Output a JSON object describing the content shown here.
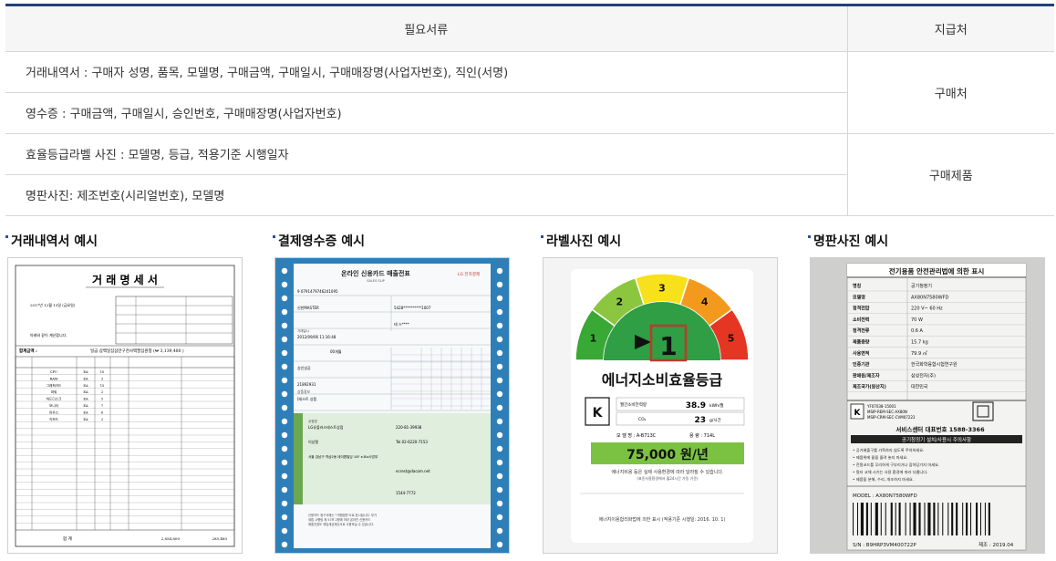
{
  "table": {
    "header_docs": "필요서류",
    "header_where": "지급처",
    "rows": [
      {
        "doc": "거래내역서 : 구매자 성명, 품목, 모델명, 구매금액, 구매일시, 구매매장명(사업자번호), 직인(서명)"
      },
      {
        "doc": "영수증 : 구매금액, 구매일시, 승인번호, 구매매장명(사업자번호)"
      },
      {
        "doc": "효율등급라벨 사진 : 모델명, 등급, 적용기준 시행일자"
      },
      {
        "doc": "명판사진: 제조번호(시리얼번호), 모델명"
      }
    ],
    "groups": [
      "구매처",
      "구매제품"
    ]
  },
  "examples": [
    {
      "title": "거래내역서 예시"
    },
    {
      "title": "결제영수증 예시"
    },
    {
      "title": "라벨사진 예시"
    },
    {
      "title": "명판사진 예시"
    }
  ],
  "invoice": {
    "title": "거 래 명 세 서",
    "date": "2017년 12월 13일 (금요일)",
    "sum_label": "합계금액 :",
    "sum_text": "일금 삼백일십삼만구천사백팔십원정 (₩ 3,139,480 )",
    "note": "아래와 같이 계산합니다.",
    "items": [
      "CPU",
      "RAM",
      "그래픽카드",
      "파워",
      "하드디스크",
      "모니터",
      "마우스",
      "키보드"
    ],
    "qtys": [
      "10",
      "3",
      "15",
      "2",
      "5",
      "7",
      "6",
      "2"
    ],
    "total_label": "합 계",
    "total_amount": "2,854,800",
    "total_tax": "285,480"
  },
  "receipt": {
    "title": "온라인 신용카드 매출전표",
    "subtitle": "SALES SLIP",
    "brand": "LG 전자결제",
    "card_no": "9 0791479746241095",
    "card_type": "신한MASTER",
    "card_num": "5428**********1007",
    "cust_name": "테 스****",
    "date_label": "거래일시",
    "date": "2012/09/06 11:16:48",
    "installment": "00개월",
    "status": "승인성공",
    "approval": "21892931",
    "product_label": "상품정보",
    "product": "[테스트 상품",
    "merchant_label": "상점명",
    "merchant": "LG유플러스테스트상점",
    "biz_no": "220-81-39938",
    "ceo": "이상철",
    "phone": "Tel.02-6220-7153",
    "address": "서울 강남구 역삼2동 데이콤빌딩 10F e-Biz사업부",
    "email": "ecrest@dacom.net",
    "cs_no": "1544-7772",
    "footer": "신용카드 청구서에는 \"가맹점명\"으로 표시됩니다. 부가세법 시행령 제 57조 2항에 따라 온라인 신용카드 매출전표도 매입세금계산서로 사용하실 수 있습니다."
  },
  "label": {
    "grades": [
      "1",
      "2",
      "3",
      "4",
      "5"
    ],
    "grade": "1",
    "heading": "에너지소비효율등급",
    "power_label": "월간소비전력량",
    "power_value": "38.9",
    "power_unit": "kWh/월",
    "co2_label": "CO₂",
    "co2_value": "23",
    "co2_unit": "g/시간",
    "model_line": "모 델 명 : A-B713C",
    "capacity": "용 량 : 714L",
    "cost": "75,000 원/년",
    "note1": "에너지비용 등은 실제 사용환경에 따라 달라질 수 있습니다.",
    "note2": "(표준사용환경에서 월24시간 가동 기준)",
    "footer": "에너지이용합리화법에 의한 표시 (적용기준 시행일: 2016. 10. 1)"
  },
  "plate": {
    "title": "전기용품 안전관리법에 의한 표시",
    "rows": [
      [
        "명칭",
        "공기청정기"
      ],
      [
        "모델명",
        "AX80N7580WFD"
      ],
      [
        "정격전압",
        "220 V~ 60 Hz"
      ],
      [
        "소비전력",
        "70 W"
      ],
      [
        "정격전류",
        "0.6 A"
      ],
      [
        "제품중량",
        "15.7 kg"
      ],
      [
        "사용면적",
        "79.9 ㎡"
      ],
      [
        "인증기관",
        "한국화학융합시험연구원"
      ],
      [
        "판매원/제조자",
        "삼성전자(주)"
      ],
      [
        "제조국가(원산지)",
        "대한민국"
      ]
    ],
    "cert_lines": [
      "YF07038-15001",
      "MSIP-REM-SEC-AX80N",
      "MSIP-CRM-SEC-CVM07223"
    ],
    "service": "서비스센터 대표번호 1588-3366",
    "warning_title": "공기청정기 설치/사용시 주의사항",
    "warnings": [
      "• 공기배출구를 가족하지 않도록 주의하세요.",
      "• 제품위에 물을 올려 놓지 마세요.",
      "• 전원코드를 무리하게 구부리거나 잡아당기지 마세요.",
      "• 필터 교체 시기는 사용 환경에 따라 다릅니다.",
      "• 제품을 분해, 수리, 개조하지 마세요."
    ],
    "model": "MODEL : AX80N7580WFD",
    "serial": "S/N : B9HRP3VM400722P",
    "mfg": "제조 : 2019.04"
  }
}
